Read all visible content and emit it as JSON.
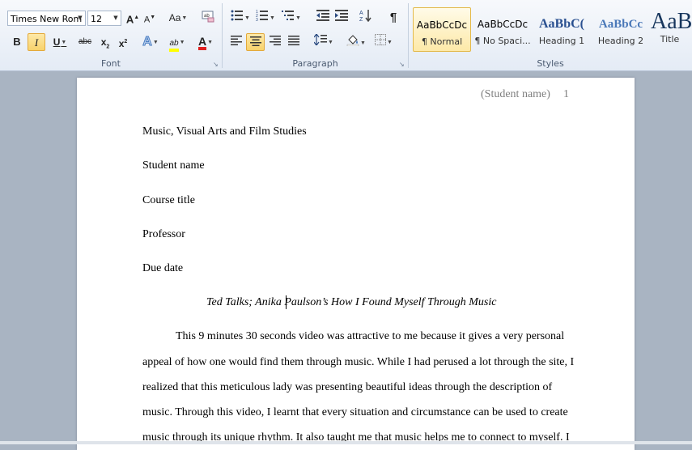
{
  "font": {
    "name": "Times New Rom",
    "size": "12",
    "label": "Font",
    "grow": "A",
    "shrink": "A",
    "case": "Aa",
    "bold": "B",
    "italic": "I",
    "underline": "U",
    "strike": "abc",
    "subscript": "x",
    "superscript": "x",
    "highlight": "ab",
    "color": "A"
  },
  "paragraph": {
    "label": "Paragraph",
    "show_marks": "¶"
  },
  "styles": {
    "label": "Styles",
    "items": [
      {
        "sample": "AaBbCcDc",
        "name": "¶ Normal"
      },
      {
        "sample": "AaBbCcDc",
        "name": "¶ No Spaci..."
      },
      {
        "sample": "AaBbC(",
        "name": "Heading 1"
      },
      {
        "sample": "AaBbCc",
        "name": "Heading 2"
      },
      {
        "sample": "AaB",
        "name": "Title"
      }
    ]
  },
  "document": {
    "header_name": "(Student name)",
    "page_number": "1",
    "lines": [
      "Music, Visual Arts and Film Studies",
      "Student name",
      "Course title",
      "Professor",
      "Due date"
    ],
    "title": "Ted Talks; Anika Paulson’s How I Found Myself Through Music",
    "body": [
      "This 9 minutes 30 seconds video was attractive to me because it gives a very personal",
      "appeal of how one would find them through music. While I had perused a lot through the site, I",
      "realized that this meticulous lady was presenting beautiful ideas through the description of",
      "music. Through this video, I learnt that every situation and circumstance can be used to create",
      "music through its unique rhythm. It also taught me that music helps me to connect to myself. I"
    ]
  },
  "colors": {
    "highlight": "#ffff00",
    "font_color": "#e02020",
    "accent": "#e3a93b"
  }
}
